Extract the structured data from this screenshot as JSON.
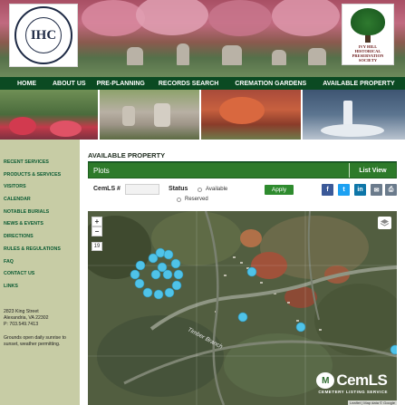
{
  "header": {
    "logo_left_initials": "IHC",
    "logo_left_ring_text": "IVY HILL CEMETERY COMPANY OF ALEXANDRIA",
    "logo_right_lines": [
      "IVY HILL",
      "HISTORICAL",
      "PRESERVATION",
      "SOCIETY"
    ]
  },
  "nav": {
    "items": [
      {
        "label": "HOME"
      },
      {
        "label": "ABOUT US"
      },
      {
        "label": "PRE-PLANNING"
      },
      {
        "label": "RECORDS SEARCH"
      },
      {
        "label": "CREMATION GARDENS"
      },
      {
        "label": "AVAILABLE PROPERTY"
      }
    ]
  },
  "sidebar": {
    "links": [
      {
        "label": "RECENT SERVICES"
      },
      {
        "label": "PRODUCTS & SERVICES"
      },
      {
        "label": "VISITORS"
      },
      {
        "label": "CALENDAR"
      },
      {
        "label": "NOTABLE BURIALS"
      },
      {
        "label": "NEWS & EVENTS"
      },
      {
        "label": "DIRECTIONS"
      },
      {
        "label": "RULES & REGULATIONS"
      },
      {
        "label": "FAQ"
      },
      {
        "label": "CONTACT US"
      },
      {
        "label": "LINKS"
      }
    ],
    "address_line1": "2823 King Street",
    "address_line2": "Alexandria, VA 22302",
    "phone": "P: 703.549.7413",
    "hours_line1": "Grounds open daily sunrise to",
    "hours_line2": "sunset, weather permitting."
  },
  "main": {
    "title": "AVAILABLE PROPERTY",
    "plots_label": "Plots",
    "list_view_label": "List View",
    "cemls_label": "CemLS #",
    "cemls_value": "",
    "status_label": "Status",
    "status_options": [
      "Available",
      "Reserved"
    ],
    "apply_label": "Apply",
    "share_icons": [
      {
        "name": "facebook-icon",
        "glyph": "f",
        "color": "#3b5998"
      },
      {
        "name": "twitter-icon",
        "glyph": "t",
        "color": "#1da1f2"
      },
      {
        "name": "linkedin-icon",
        "glyph": "in",
        "color": "#0e76a8"
      },
      {
        "name": "email-icon",
        "glyph": "✉",
        "color": "#6b7b8c"
      },
      {
        "name": "print-icon",
        "glyph": "⎙",
        "color": "#6b7b8c"
      }
    ]
  },
  "map": {
    "zoom_in": "+",
    "zoom_out": "−",
    "zoom_level": "19",
    "road_label": "Timber Branch",
    "logo_badge": "M",
    "logo_text": "CemLS",
    "logo_sub": "CEMETERY LISTING SERVICE",
    "attribution": "Leaflet | Map data © Google",
    "marker_color": "#4fc3e8"
  }
}
